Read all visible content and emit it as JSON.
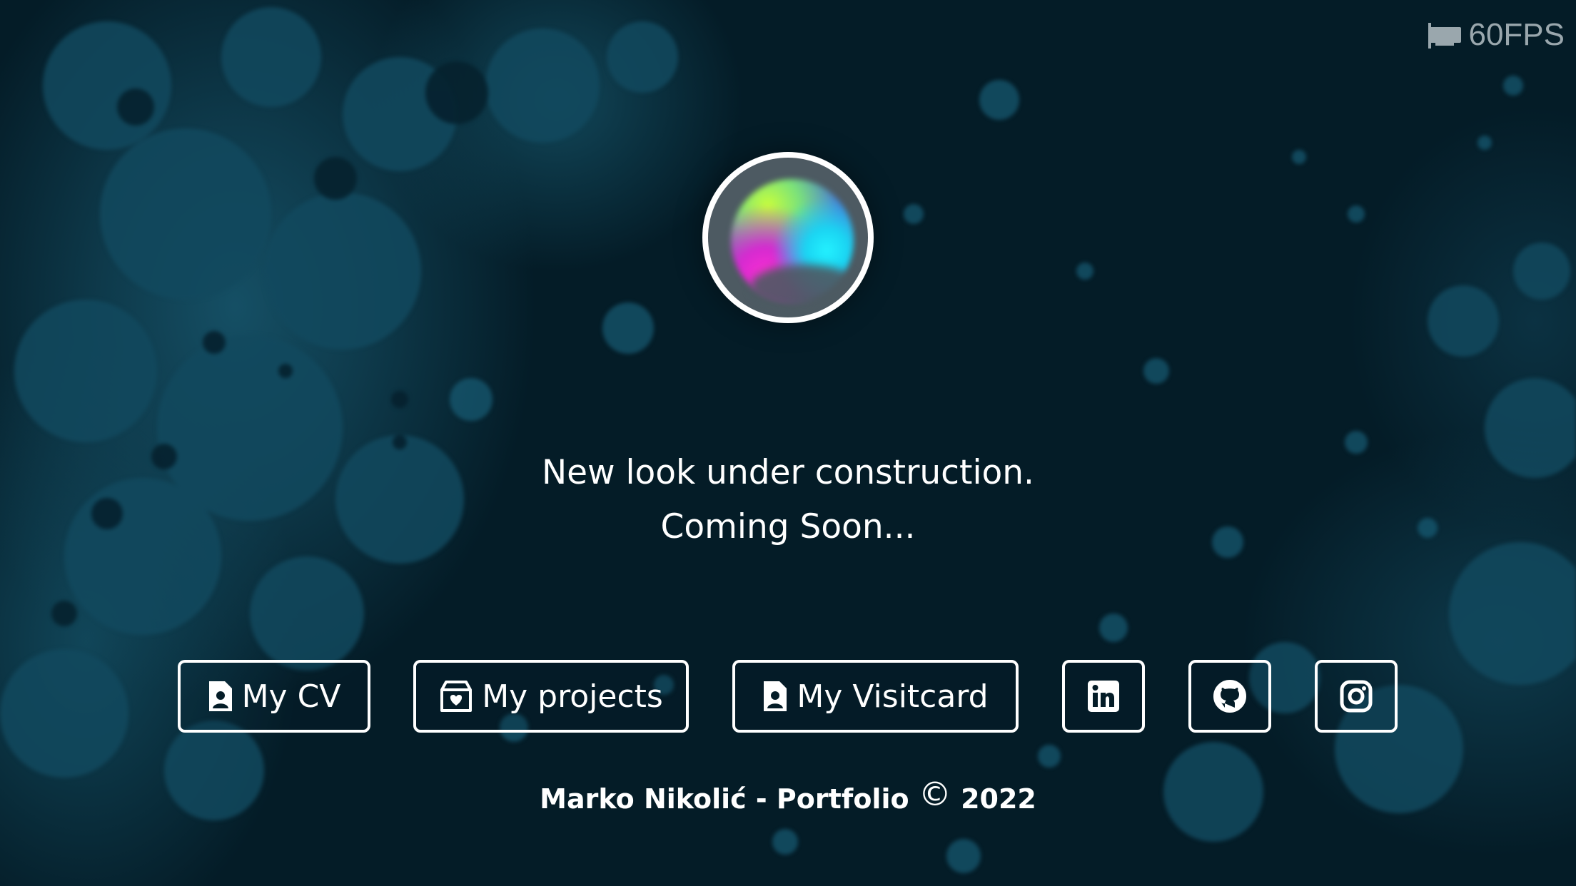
{
  "fps_counter": {
    "label": "60FPS",
    "icon": "gpu-card-icon"
  },
  "avatar": {
    "icon": "gradient-orb-avatar"
  },
  "message": {
    "line1": "New look under construction.",
    "line2": "Coming Soon..."
  },
  "buttons": {
    "cv": {
      "label": "My CV",
      "icon": "document-person-icon"
    },
    "projects": {
      "label": "My projects",
      "icon": "box-heart-icon"
    },
    "visitcard": {
      "label": "My Visitcard",
      "icon": "document-person-icon"
    },
    "linkedin": {
      "icon": "linkedin-icon"
    },
    "github": {
      "icon": "github-icon"
    },
    "instagram": {
      "icon": "instagram-icon"
    }
  },
  "footer": {
    "name": "Marko Nikolić - Portfolio",
    "copyright_symbol": "©",
    "year": "2022"
  },
  "colors": {
    "background": "#041c27",
    "blob": "#165268",
    "text": "#ffffff",
    "fps_text": "#9aa7ad"
  }
}
